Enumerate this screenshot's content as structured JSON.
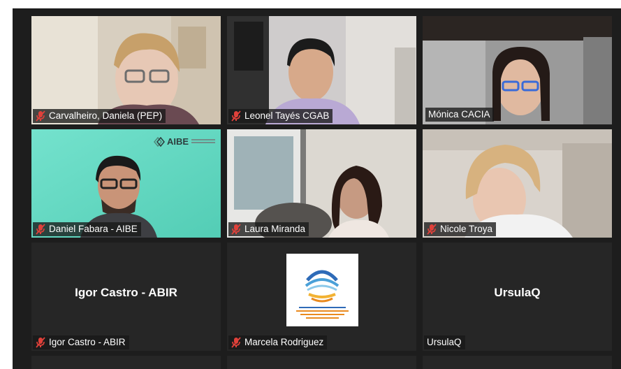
{
  "participants": [
    {
      "name": "Carvalheiro, Daniela (PEP)",
      "muted": true
    },
    {
      "name": "Leonel Tayés CGAB",
      "muted": true
    },
    {
      "name": "Mónica CACIA",
      "muted": false,
      "speaking": true
    },
    {
      "name": "Daniel Fabara - AIBE",
      "muted": true,
      "background_logo": "AIBE"
    },
    {
      "name": "Laura Miranda",
      "muted": true
    },
    {
      "name": "Nicole Troya",
      "muted": true
    },
    {
      "name": "Igor Castro - ABIR",
      "display_name": "Igor Castro - ABIR",
      "muted": true
    },
    {
      "name": "Marcela Rodriguez",
      "muted": true
    },
    {
      "name": "UrsulaQ",
      "display_name": "UrsulaQ",
      "muted": false
    }
  ],
  "colors": {
    "speaking_border": "#c6e25a",
    "muted_icon": "#e0413a",
    "tile_background": "#262626",
    "screen_background": "#1d1d1d"
  },
  "icons": {
    "muted": "mic-muted-icon"
  }
}
